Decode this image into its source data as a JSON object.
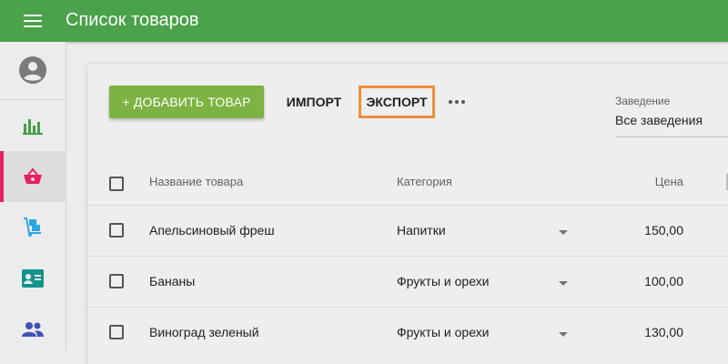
{
  "app": {
    "title": "Список товаров"
  },
  "sidebar": {
    "items": [
      {
        "name": "profile",
        "icon": "account-circle-icon",
        "color": "#7a7a7a"
      },
      {
        "name": "analytics",
        "icon": "bar-chart-icon",
        "color": "#43a047"
      },
      {
        "name": "products",
        "icon": "basket-icon",
        "color": "#e91e63",
        "active": true
      },
      {
        "name": "warehouse",
        "icon": "hand-truck-icon",
        "color": "#29a7e1"
      },
      {
        "name": "contacts",
        "icon": "contact-card-icon",
        "color": "#12948a"
      },
      {
        "name": "team",
        "icon": "people-icon",
        "color": "#3f51b5"
      }
    ]
  },
  "toolbar": {
    "add_label": "+ ДОБАВИТЬ ТОВАР",
    "import_label": "ИМПОРТ",
    "export_label": "ЭКСПОРТ",
    "more_icon": "more-horizontal-icon"
  },
  "filter": {
    "label": "Заведение",
    "value": "Все заведения"
  },
  "table": {
    "headers": {
      "name": "Название товара",
      "category": "Категория",
      "price": "Цена"
    },
    "rows": [
      {
        "name": "Апельсиновый фреш",
        "category": "Напитки",
        "price": "150,00"
      },
      {
        "name": "Бананы",
        "category": "Фрукты и орехи",
        "price": "100,00"
      },
      {
        "name": "Виноград зеленый",
        "category": "Фрукты и орехи",
        "price": "130,00"
      }
    ]
  },
  "colors": {
    "appbar": "#4aa24a",
    "add_button": "#7cb342",
    "export_highlight": "#ef8f3c",
    "active_indicator": "#e91e63"
  }
}
